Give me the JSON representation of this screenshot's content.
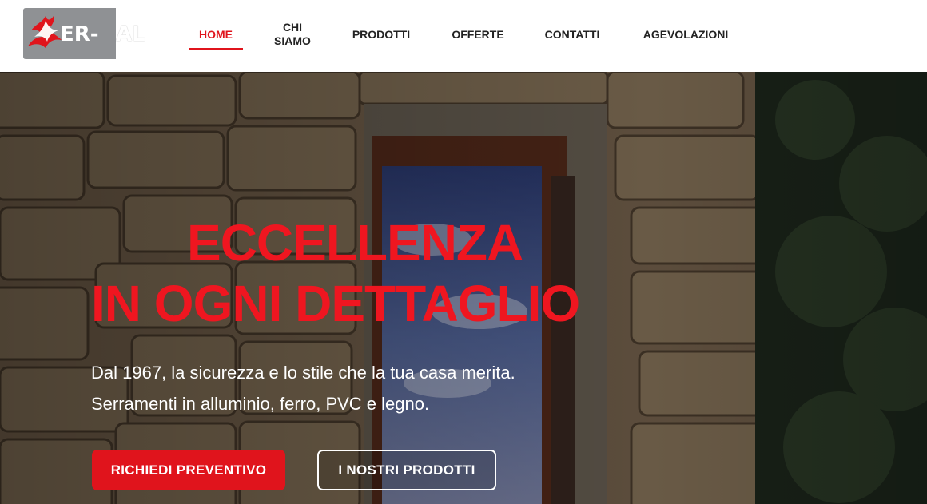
{
  "brand": {
    "logo_text": "ER-AL",
    "logo_text_left": "ER-",
    "logo_text_right": "AL",
    "colors": {
      "accent": "#e0141c",
      "logo_gray": "#8f9194"
    }
  },
  "nav": {
    "items": [
      {
        "label": "HOME",
        "active": true
      },
      {
        "label": "CHI",
        "label2": "SIAMO"
      },
      {
        "label": "PRODOTTI"
      },
      {
        "label": "OFFERTE"
      },
      {
        "label": "CONTATTI"
      },
      {
        "label": "AGEVOLAZIONI"
      }
    ]
  },
  "hero": {
    "headline_line1": "ECCELLENZA",
    "headline_line2": "IN OGNI DETTAGLIO",
    "subtitle_line1": "Dal 1967, la sicurezza e lo stile che la tua casa merita.",
    "subtitle_line2": "Serramenti in alluminio, ferro, PVC e legno.",
    "primary_button": "RICHIEDI PREVENTIVO",
    "secondary_button": "I NOSTRI PRODOTTI"
  }
}
